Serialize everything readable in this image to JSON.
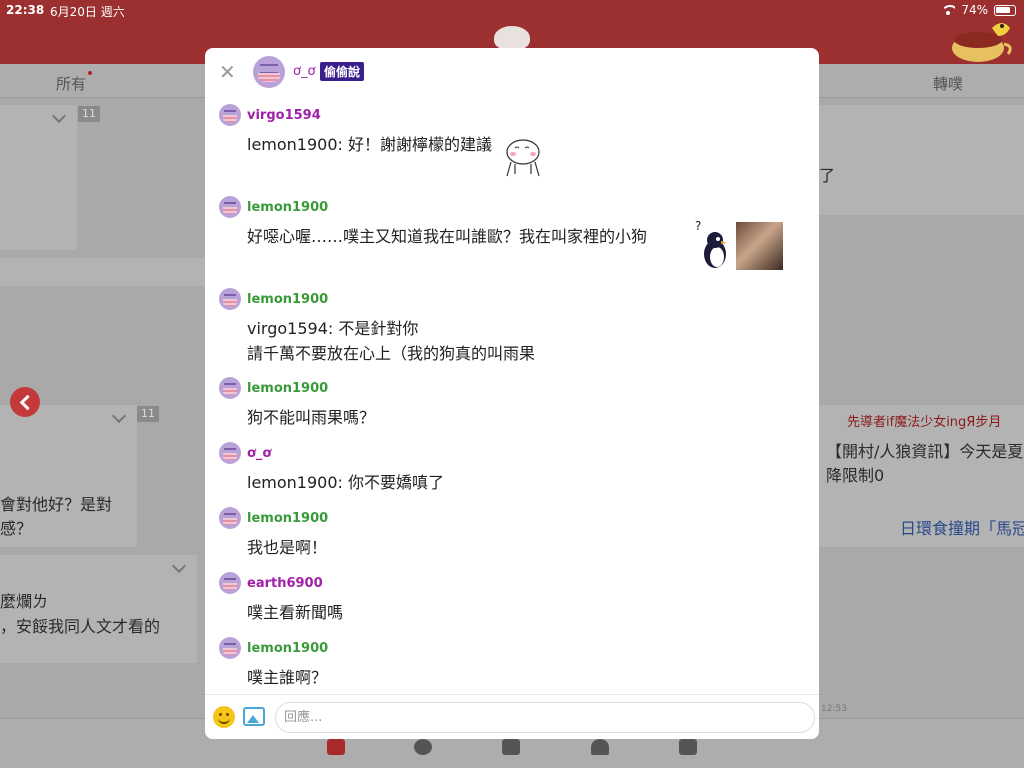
{
  "status_bar": {
    "time": "22:38",
    "date": "6月20日 週六",
    "battery": "74%"
  },
  "tabs": {
    "all": "所有",
    "replurk": "轉噗"
  },
  "background": {
    "t1": "了",
    "t2": "會對他好？是對",
    "t3": "感？",
    "t4": "麼爛ㄌ",
    "t5": "，安餒我同人文才看的",
    "badge": "11",
    "right_user": "先導者if魔法少女ingЯ步月",
    "right_text1": "【開村/人狼資訊】今天是夏",
    "right_text2": "降限制0",
    "right_news": "日環食撞期「馬冠",
    "time_small": "12:53"
  },
  "modal": {
    "header_name": "ơ_ơ",
    "header_badge": "偷偷說",
    "messages": [
      {
        "user": "virgo1594",
        "color": "purple",
        "lines": [
          "lemon1900: 好！謝謝檸檬的建議"
        ]
      },
      {
        "user": "lemon1900",
        "color": "green",
        "lines": [
          "好噁心喔……噗主又知道我在叫誰歐？我在叫家裡的小狗"
        ]
      },
      {
        "user": "lemon1900",
        "color": "green",
        "lines": [
          "virgo1594: 不是針對你",
          "請千萬不要放在心上（我的狗真的叫雨果"
        ]
      },
      {
        "user": "lemon1900",
        "color": "green",
        "lines": [
          "狗不能叫雨果嗎？"
        ]
      },
      {
        "user": "ơ_ơ",
        "color": "purple",
        "lines": [
          "lemon1900: 你不要嬌嗔了"
        ]
      },
      {
        "user": "lemon1900",
        "color": "green",
        "lines": [
          "我也是啊！"
        ]
      },
      {
        "user": "earth6900",
        "color": "purple",
        "lines": [
          "噗主看新聞嗎"
        ]
      },
      {
        "user": "lemon1900",
        "color": "green",
        "lines": [
          "噗主誰啊？"
        ]
      }
    ],
    "reply_placeholder": "回應..."
  }
}
